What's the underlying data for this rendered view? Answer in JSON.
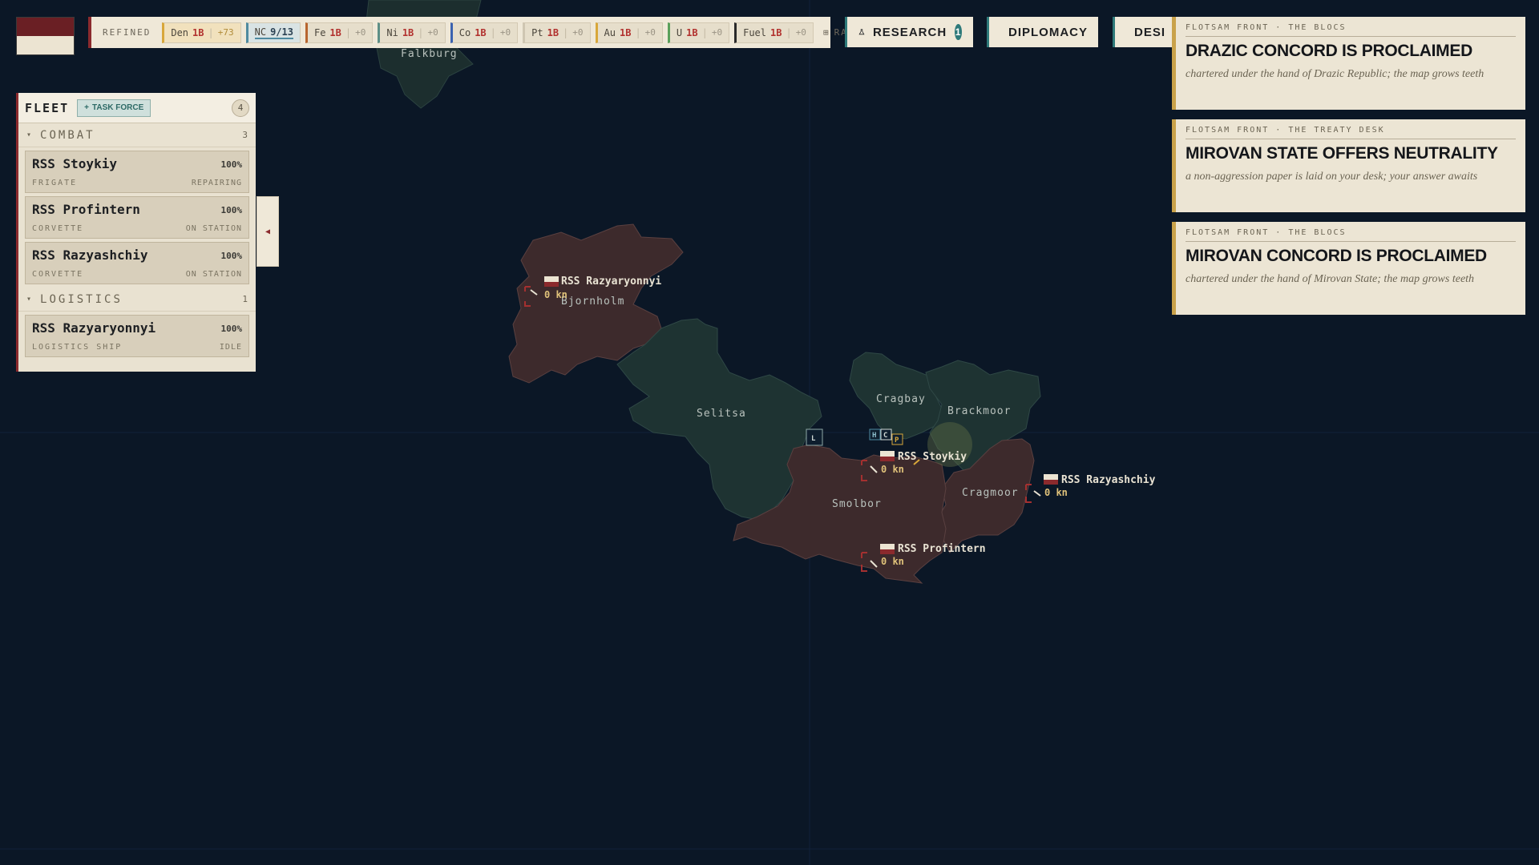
{
  "resources": {
    "refined_label": "REFINED",
    "raw_label": "RAW",
    "den": {
      "name": "Den",
      "amount": "1B",
      "delta": "+73"
    },
    "nc": {
      "name": "NC",
      "amount": "9/13"
    },
    "items": [
      {
        "name": "Fe",
        "amount": "1B",
        "delta": "+0",
        "color": "#b8652e"
      },
      {
        "name": "Ni",
        "amount": "1B",
        "delta": "+0",
        "color": "#5d8f86"
      },
      {
        "name": "Co",
        "amount": "1B",
        "delta": "+0",
        "color": "#3b62b0"
      },
      {
        "name": "Pt",
        "amount": "1B",
        "delta": "+0",
        "color": "#cfc6b2"
      },
      {
        "name": "Au",
        "amount": "1B",
        "delta": "+0",
        "color": "#d8a73a"
      },
      {
        "name": "U",
        "amount": "1B",
        "delta": "+0",
        "color": "#5aa05a"
      },
      {
        "name": "Fuel",
        "amount": "1B",
        "delta": "+0",
        "color": "#2a2a2a"
      }
    ]
  },
  "top_buttons": {
    "research": {
      "label": "RESEARCH",
      "badge": "1"
    },
    "diplomacy": {
      "label": "DIPLOMACY"
    },
    "third": {
      "label": "DESI"
    }
  },
  "fleet": {
    "title": "FLEET",
    "task_force_label": "TASK FORCE",
    "count": "4",
    "combat": {
      "label": "COMBAT",
      "count": "3"
    },
    "logistics": {
      "label": "LOGISTICS",
      "count": "1"
    },
    "ships": [
      {
        "name": "RSS Stoykiy",
        "hp": "100%",
        "class": "FRIGATE",
        "status": "REPAIRING"
      },
      {
        "name": "RSS Profintern",
        "hp": "100%",
        "class": "CORVETTE",
        "status": "ON STATION"
      },
      {
        "name": "RSS Razyashchiy",
        "hp": "100%",
        "class": "CORVETTE",
        "status": "ON STATION"
      },
      {
        "name": "RSS Razyaryonnyi",
        "hp": "100%",
        "class": "LOGISTICS SHIP",
        "status": "IDLE"
      }
    ]
  },
  "news": [
    {
      "kicker": "FLOTSAM FRONT · THE BLOCS",
      "headline": "DRAZIC CONCORD IS PROCLAIMED",
      "body": "chartered under the hand of Drazic Republic; the map grows teeth"
    },
    {
      "kicker": "FLOTSAM FRONT · THE TREATY DESK",
      "headline": "MIROVAN STATE OFFERS NEUTRALITY",
      "body": "a non-aggression paper is laid on your desk; your answer awaits"
    },
    {
      "kicker": "FLOTSAM FRONT · THE BLOCS",
      "headline": "MIROVAN CONCORD IS PROCLAIMED",
      "body": "chartered under the hand of Mirovan State; the map grows teeth"
    }
  ],
  "map": {
    "regions": [
      "Falkburg",
      "Bjornholm",
      "Selitsa",
      "Cragbay",
      "Brackmoor",
      "Cragmoor",
      "Smolbor"
    ],
    "markers": [
      "L",
      "H",
      "C",
      "P"
    ],
    "ships": [
      {
        "name": "RSS Razyaryonnyi",
        "speed": "0 kn"
      },
      {
        "name": "RSS Stoykiy",
        "speed": "0 kn"
      },
      {
        "name": "RSS Razyashchiy",
        "speed": "0 kn"
      },
      {
        "name": "RSS Profintern",
        "speed": "0 kn"
      }
    ]
  },
  "colors": {
    "owned": "#3d2a2c",
    "neutral": "#1e3332",
    "accent": "#2e7a7a",
    "brand": "#8b2a2d"
  }
}
